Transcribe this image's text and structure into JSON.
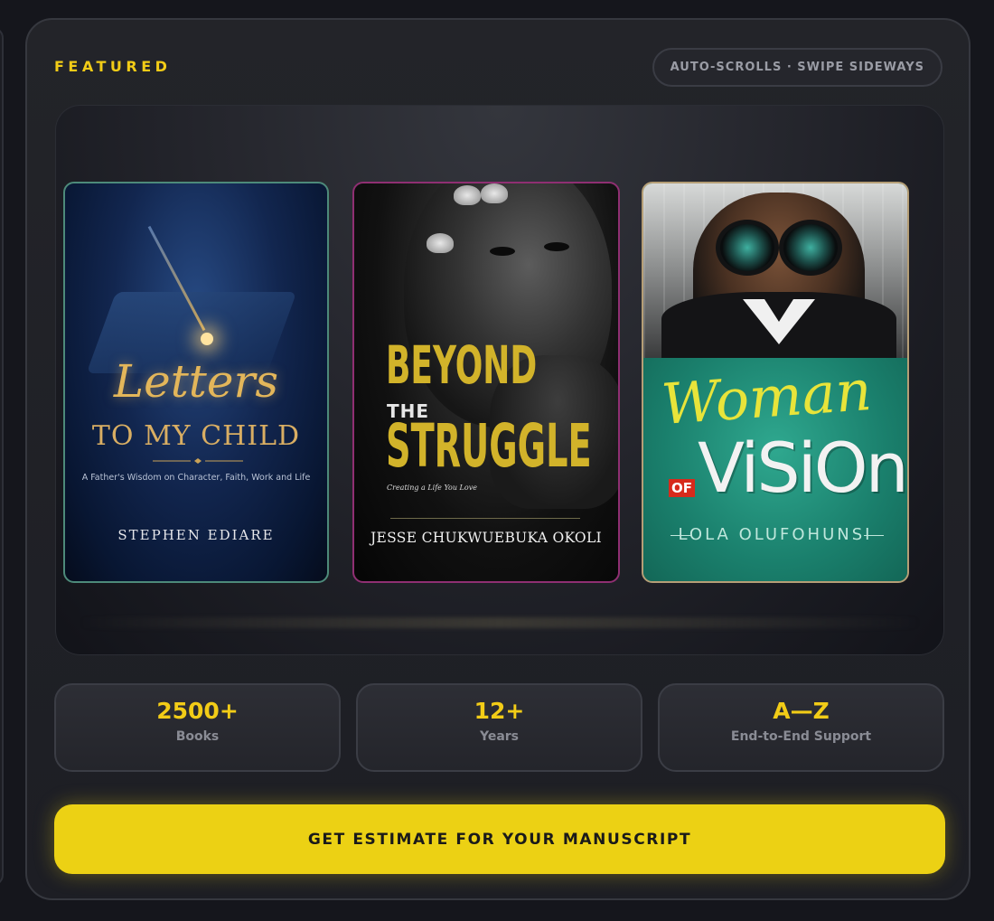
{
  "section": {
    "heading": "FEATURED",
    "hint": "AUTO-SCROLLS · SWIPE SIDEWAYS"
  },
  "books": [
    {
      "title_script": "Letters",
      "title_main": "TO MY CHILD",
      "subtitle": "A Father's Wisdom on Character, Faith, Work and Life",
      "author": "STEPHEN EDIARE",
      "border_color": "#4d8a7a"
    },
    {
      "title_top": "BEYOND",
      "title_mid": "THE",
      "title_bottom": "STRUGGLE",
      "subtitle": "Creating a Life You Love",
      "author": "JESSE CHUKWUEBUKA OKOLI",
      "border_color": "#8f2f72"
    },
    {
      "title_script": "Woman",
      "title_of": "OF",
      "title_main": "ViSiOn",
      "author": "LOLA OLUFOHUNSI",
      "border_color": "#b59e76"
    }
  ],
  "stats": [
    {
      "value": "2500+",
      "label": "Books"
    },
    {
      "value": "12+",
      "label": "Years"
    },
    {
      "value": "A—Z",
      "label": "End-to-End Support"
    }
  ],
  "cta": {
    "label": "GET ESTIMATE FOR YOUR MANUSCRIPT"
  },
  "colors": {
    "accent": "#f2cc17",
    "cta_bg": "#ecd114",
    "panel_bg": "#232429"
  }
}
